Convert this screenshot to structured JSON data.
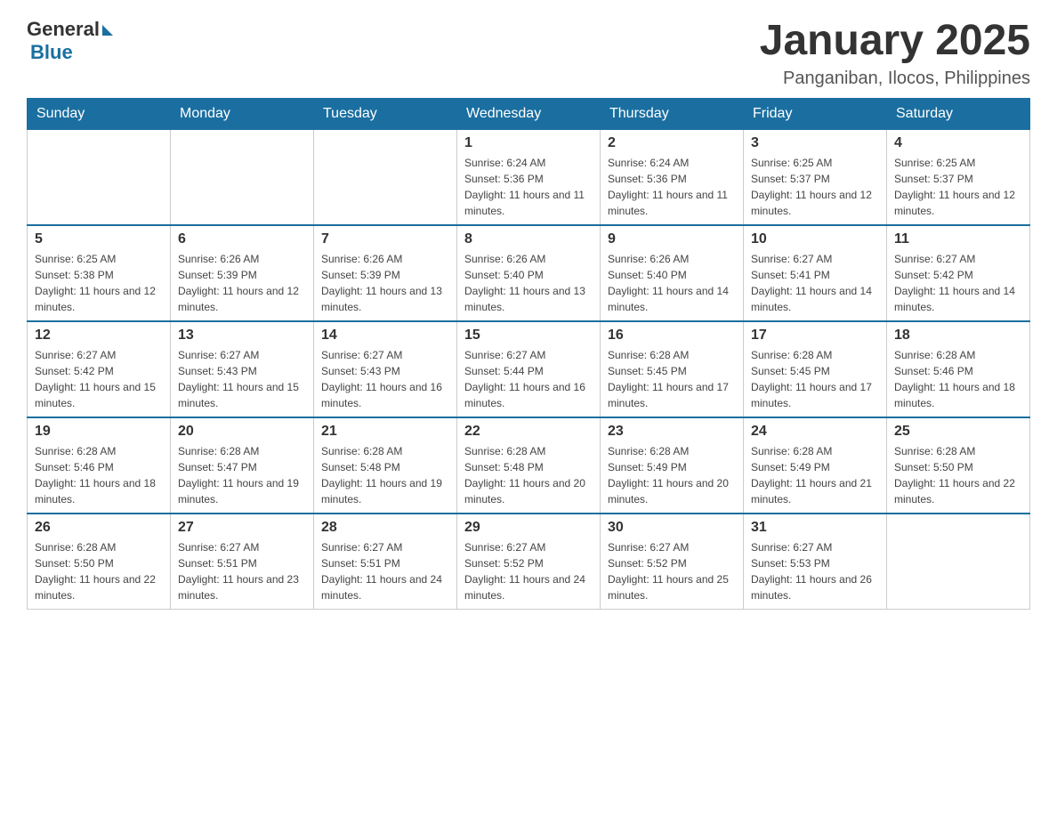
{
  "header": {
    "logo": {
      "general": "General",
      "triangle": "▶",
      "blue": "Blue"
    },
    "title": "January 2025",
    "subtitle": "Panganiban, Ilocos, Philippines"
  },
  "days_of_week": [
    "Sunday",
    "Monday",
    "Tuesday",
    "Wednesday",
    "Thursday",
    "Friday",
    "Saturday"
  ],
  "weeks": [
    [
      {
        "day": "",
        "sunrise": "",
        "sunset": "",
        "daylight": ""
      },
      {
        "day": "",
        "sunrise": "",
        "sunset": "",
        "daylight": ""
      },
      {
        "day": "",
        "sunrise": "",
        "sunset": "",
        "daylight": ""
      },
      {
        "day": "1",
        "sunrise": "Sunrise: 6:24 AM",
        "sunset": "Sunset: 5:36 PM",
        "daylight": "Daylight: 11 hours and 11 minutes."
      },
      {
        "day": "2",
        "sunrise": "Sunrise: 6:24 AM",
        "sunset": "Sunset: 5:36 PM",
        "daylight": "Daylight: 11 hours and 11 minutes."
      },
      {
        "day": "3",
        "sunrise": "Sunrise: 6:25 AM",
        "sunset": "Sunset: 5:37 PM",
        "daylight": "Daylight: 11 hours and 12 minutes."
      },
      {
        "day": "4",
        "sunrise": "Sunrise: 6:25 AM",
        "sunset": "Sunset: 5:37 PM",
        "daylight": "Daylight: 11 hours and 12 minutes."
      }
    ],
    [
      {
        "day": "5",
        "sunrise": "Sunrise: 6:25 AM",
        "sunset": "Sunset: 5:38 PM",
        "daylight": "Daylight: 11 hours and 12 minutes."
      },
      {
        "day": "6",
        "sunrise": "Sunrise: 6:26 AM",
        "sunset": "Sunset: 5:39 PM",
        "daylight": "Daylight: 11 hours and 12 minutes."
      },
      {
        "day": "7",
        "sunrise": "Sunrise: 6:26 AM",
        "sunset": "Sunset: 5:39 PM",
        "daylight": "Daylight: 11 hours and 13 minutes."
      },
      {
        "day": "8",
        "sunrise": "Sunrise: 6:26 AM",
        "sunset": "Sunset: 5:40 PM",
        "daylight": "Daylight: 11 hours and 13 minutes."
      },
      {
        "day": "9",
        "sunrise": "Sunrise: 6:26 AM",
        "sunset": "Sunset: 5:40 PM",
        "daylight": "Daylight: 11 hours and 14 minutes."
      },
      {
        "day": "10",
        "sunrise": "Sunrise: 6:27 AM",
        "sunset": "Sunset: 5:41 PM",
        "daylight": "Daylight: 11 hours and 14 minutes."
      },
      {
        "day": "11",
        "sunrise": "Sunrise: 6:27 AM",
        "sunset": "Sunset: 5:42 PM",
        "daylight": "Daylight: 11 hours and 14 minutes."
      }
    ],
    [
      {
        "day": "12",
        "sunrise": "Sunrise: 6:27 AM",
        "sunset": "Sunset: 5:42 PM",
        "daylight": "Daylight: 11 hours and 15 minutes."
      },
      {
        "day": "13",
        "sunrise": "Sunrise: 6:27 AM",
        "sunset": "Sunset: 5:43 PM",
        "daylight": "Daylight: 11 hours and 15 minutes."
      },
      {
        "day": "14",
        "sunrise": "Sunrise: 6:27 AM",
        "sunset": "Sunset: 5:43 PM",
        "daylight": "Daylight: 11 hours and 16 minutes."
      },
      {
        "day": "15",
        "sunrise": "Sunrise: 6:27 AM",
        "sunset": "Sunset: 5:44 PM",
        "daylight": "Daylight: 11 hours and 16 minutes."
      },
      {
        "day": "16",
        "sunrise": "Sunrise: 6:28 AM",
        "sunset": "Sunset: 5:45 PM",
        "daylight": "Daylight: 11 hours and 17 minutes."
      },
      {
        "day": "17",
        "sunrise": "Sunrise: 6:28 AM",
        "sunset": "Sunset: 5:45 PM",
        "daylight": "Daylight: 11 hours and 17 minutes."
      },
      {
        "day": "18",
        "sunrise": "Sunrise: 6:28 AM",
        "sunset": "Sunset: 5:46 PM",
        "daylight": "Daylight: 11 hours and 18 minutes."
      }
    ],
    [
      {
        "day": "19",
        "sunrise": "Sunrise: 6:28 AM",
        "sunset": "Sunset: 5:46 PM",
        "daylight": "Daylight: 11 hours and 18 minutes."
      },
      {
        "day": "20",
        "sunrise": "Sunrise: 6:28 AM",
        "sunset": "Sunset: 5:47 PM",
        "daylight": "Daylight: 11 hours and 19 minutes."
      },
      {
        "day": "21",
        "sunrise": "Sunrise: 6:28 AM",
        "sunset": "Sunset: 5:48 PM",
        "daylight": "Daylight: 11 hours and 19 minutes."
      },
      {
        "day": "22",
        "sunrise": "Sunrise: 6:28 AM",
        "sunset": "Sunset: 5:48 PM",
        "daylight": "Daylight: 11 hours and 20 minutes."
      },
      {
        "day": "23",
        "sunrise": "Sunrise: 6:28 AM",
        "sunset": "Sunset: 5:49 PM",
        "daylight": "Daylight: 11 hours and 20 minutes."
      },
      {
        "day": "24",
        "sunrise": "Sunrise: 6:28 AM",
        "sunset": "Sunset: 5:49 PM",
        "daylight": "Daylight: 11 hours and 21 minutes."
      },
      {
        "day": "25",
        "sunrise": "Sunrise: 6:28 AM",
        "sunset": "Sunset: 5:50 PM",
        "daylight": "Daylight: 11 hours and 22 minutes."
      }
    ],
    [
      {
        "day": "26",
        "sunrise": "Sunrise: 6:28 AM",
        "sunset": "Sunset: 5:50 PM",
        "daylight": "Daylight: 11 hours and 22 minutes."
      },
      {
        "day": "27",
        "sunrise": "Sunrise: 6:27 AM",
        "sunset": "Sunset: 5:51 PM",
        "daylight": "Daylight: 11 hours and 23 minutes."
      },
      {
        "day": "28",
        "sunrise": "Sunrise: 6:27 AM",
        "sunset": "Sunset: 5:51 PM",
        "daylight": "Daylight: 11 hours and 24 minutes."
      },
      {
        "day": "29",
        "sunrise": "Sunrise: 6:27 AM",
        "sunset": "Sunset: 5:52 PM",
        "daylight": "Daylight: 11 hours and 24 minutes."
      },
      {
        "day": "30",
        "sunrise": "Sunrise: 6:27 AM",
        "sunset": "Sunset: 5:52 PM",
        "daylight": "Daylight: 11 hours and 25 minutes."
      },
      {
        "day": "31",
        "sunrise": "Sunrise: 6:27 AM",
        "sunset": "Sunset: 5:53 PM",
        "daylight": "Daylight: 11 hours and 26 minutes."
      },
      {
        "day": "",
        "sunrise": "",
        "sunset": "",
        "daylight": ""
      }
    ]
  ]
}
